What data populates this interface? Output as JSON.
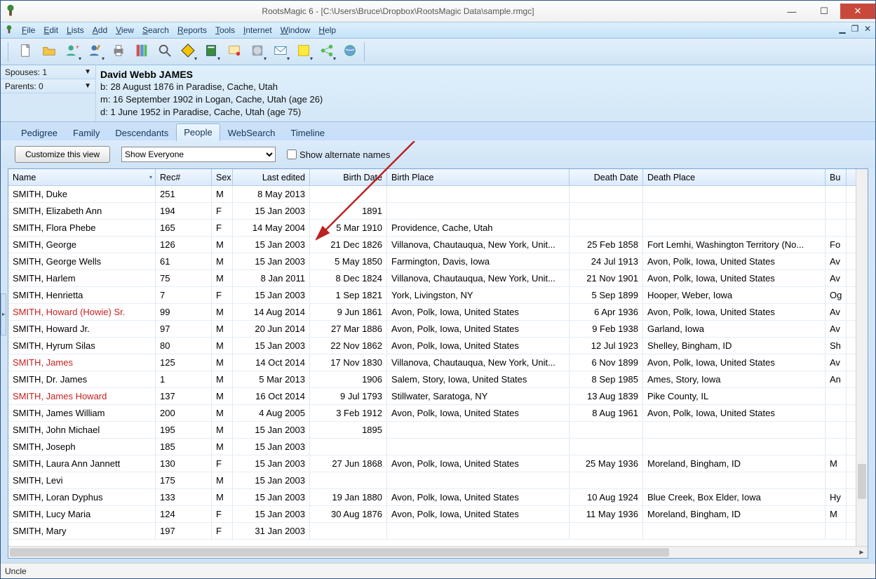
{
  "window": {
    "title": "RootsMagic 6 - [C:\\Users\\Bruce\\Dropbox\\RootsMagic Data\\sample.rmgc]"
  },
  "menu": [
    "File",
    "Edit",
    "Lists",
    "Add",
    "View",
    "Search",
    "Reports",
    "Tools",
    "Internet",
    "Window",
    "Help"
  ],
  "side": {
    "spouses": "Spouses: 1",
    "parents": "Parents: 0"
  },
  "person": {
    "name": "David Webb JAMES",
    "b": "b: 28 August 1876 in Paradise, Cache, Utah",
    "m": "m: 16 September 1902 in Logan, Cache, Utah (age 26)",
    "d": "d: 1 June 1952 in Paradise, Cache, Utah (age 75)"
  },
  "tabs": [
    "Pedigree",
    "Family",
    "Descendants",
    "People",
    "WebSearch",
    "Timeline"
  ],
  "active_tab": 3,
  "controls": {
    "customize": "Customize this view",
    "show": "Show Everyone",
    "alt": "Show alternate names"
  },
  "columns": [
    {
      "key": "name",
      "label": "Name",
      "cls": "c-name"
    },
    {
      "key": "rec",
      "label": "Rec#",
      "cls": "c-rec"
    },
    {
      "key": "sex",
      "label": "Sex",
      "cls": "c-sex"
    },
    {
      "key": "le",
      "label": "Last edited",
      "cls": "c-le",
      "right": true
    },
    {
      "key": "bd",
      "label": "Birth Date",
      "cls": "c-bd",
      "right": true
    },
    {
      "key": "bp",
      "label": "Birth Place",
      "cls": "c-bp"
    },
    {
      "key": "dd",
      "label": "Death Date",
      "cls": "c-dd",
      "right": true
    },
    {
      "key": "dp",
      "label": "Death Place",
      "cls": "c-dp"
    },
    {
      "key": "bu",
      "label": "Bu",
      "cls": "c-bu"
    }
  ],
  "rows": [
    {
      "name": "SMITH, Duke",
      "rec": "251",
      "sex": "M",
      "le": "8 May 2013",
      "bd": "",
      "bp": "",
      "dd": "",
      "dp": "",
      "bu": ""
    },
    {
      "name": "SMITH, Elizabeth Ann",
      "rec": "194",
      "sex": "F",
      "le": "15 Jan 2003",
      "bd": "1891",
      "bp": "",
      "dd": "",
      "dp": "",
      "bu": ""
    },
    {
      "name": "SMITH, Flora Phebe",
      "rec": "165",
      "sex": "F",
      "le": "14 May 2004",
      "bd": "5 Mar 1910",
      "bp": "Providence, Cache, Utah",
      "dd": "",
      "dp": "",
      "bu": ""
    },
    {
      "name": "SMITH, George",
      "rec": "126",
      "sex": "M",
      "le": "15 Jan 2003",
      "bd": "21 Dec 1826",
      "bp": "Villanova, Chautauqua, New York, Unit...",
      "dd": "25 Feb 1858",
      "dp": "Fort Lemhi, Washington Territory (No...",
      "bu": "Fo"
    },
    {
      "name": "SMITH, George Wells",
      "rec": "61",
      "sex": "M",
      "le": "15 Jan 2003",
      "bd": "5 May 1850",
      "bp": "Farmington, Davis, Iowa",
      "dd": "24 Jul 1913",
      "dp": "Avon, Polk, Iowa, United States",
      "bu": "Av"
    },
    {
      "name": "SMITH, Harlem",
      "rec": "75",
      "sex": "M",
      "le": "8 Jan 2011",
      "bd": "8 Dec 1824",
      "bp": "Villanova, Chautauqua, New York, Unit...",
      "dd": "21 Nov 1901",
      "dp": "Avon, Polk, Iowa, United States",
      "bu": "Av"
    },
    {
      "name": "SMITH, Henrietta",
      "rec": "7",
      "sex": "F",
      "le": "15 Jan 2003",
      "bd": "1 Sep 1821",
      "bp": "York, Livingston, NY",
      "dd": "5 Sep 1899",
      "dp": "Hooper, Weber, Iowa",
      "bu": "Og"
    },
    {
      "name": "SMITH, Howard (Howie) Sr.",
      "rec": "99",
      "sex": "M",
      "le": "14 Aug 2014",
      "bd": "9 Jun 1861",
      "bp": "Avon, Polk, Iowa, United States",
      "dd": "6 Apr 1936",
      "dp": "Avon, Polk, Iowa, United States",
      "bu": "Av",
      "red": true
    },
    {
      "name": "SMITH, Howard Jr.",
      "rec": "97",
      "sex": "M",
      "le": "20 Jun 2014",
      "bd": "27 Mar 1886",
      "bp": "Avon, Polk, Iowa, United States",
      "dd": "9 Feb 1938",
      "dp": "Garland, Iowa",
      "bu": "Av"
    },
    {
      "name": "SMITH, Hyrum Silas",
      "rec": "80",
      "sex": "M",
      "le": "15 Jan 2003",
      "bd": "22 Nov 1862",
      "bp": "Avon, Polk, Iowa, United States",
      "dd": "12 Jul 1923",
      "dp": "Shelley, Bingham, ID",
      "bu": "Sh"
    },
    {
      "name": "SMITH, James",
      "rec": "125",
      "sex": "M",
      "le": "14 Oct 2014",
      "bd": "17 Nov 1830",
      "bp": "Villanova, Chautauqua, New York, Unit...",
      "dd": "6 Nov 1899",
      "dp": "Avon, Polk, Iowa, United States",
      "bu": "Av",
      "red": true
    },
    {
      "name": "SMITH, Dr. James",
      "rec": "1",
      "sex": "M",
      "le": "5 Mar 2013",
      "bd": "1906",
      "bp": "Salem, Story, Iowa, United States",
      "dd": "8 Sep 1985",
      "dp": "Ames, Story, Iowa",
      "bu": "An"
    },
    {
      "name": "SMITH, James Howard",
      "rec": "137",
      "sex": "M",
      "le": "16 Oct 2014",
      "bd": "9 Jul 1793",
      "bp": "Stillwater, Saratoga, NY",
      "dd": "13 Aug 1839",
      "dp": "Pike County, IL",
      "bu": "",
      "red": true
    },
    {
      "name": "SMITH, James William",
      "rec": "200",
      "sex": "M",
      "le": "4 Aug 2005",
      "bd": "3 Feb 1912",
      "bp": "Avon, Polk, Iowa, United States",
      "dd": "8 Aug 1961",
      "dp": "Avon, Polk, Iowa, United States",
      "bu": ""
    },
    {
      "name": "SMITH, John Michael",
      "rec": "195",
      "sex": "M",
      "le": "15 Jan 2003",
      "bd": "1895",
      "bp": "",
      "dd": "",
      "dp": "",
      "bu": ""
    },
    {
      "name": "SMITH, Joseph",
      "rec": "185",
      "sex": "M",
      "le": "15 Jan 2003",
      "bd": "",
      "bp": "",
      "dd": "",
      "dp": "",
      "bu": ""
    },
    {
      "name": "SMITH, Laura Ann Jannett",
      "rec": "130",
      "sex": "F",
      "le": "15 Jan 2003",
      "bd": "27 Jun 1868",
      "bp": "Avon, Polk, Iowa, United States",
      "dd": "25 May 1936",
      "dp": "Moreland, Bingham, ID",
      "bu": "M"
    },
    {
      "name": "SMITH, Levi",
      "rec": "175",
      "sex": "M",
      "le": "15 Jan 2003",
      "bd": "",
      "bp": "",
      "dd": "",
      "dp": "",
      "bu": ""
    },
    {
      "name": "SMITH, Loran Dyphus",
      "rec": "133",
      "sex": "M",
      "le": "15 Jan 2003",
      "bd": "19 Jan 1880",
      "bp": "Avon, Polk, Iowa, United States",
      "dd": "10 Aug 1924",
      "dp": "Blue Creek, Box Elder, Iowa",
      "bu": "Hy"
    },
    {
      "name": "SMITH, Lucy Maria",
      "rec": "124",
      "sex": "F",
      "le": "15 Jan 2003",
      "bd": "30 Aug 1876",
      "bp": "Avon, Polk, Iowa, United States",
      "dd": "11 May 1936",
      "dp": "Moreland, Bingham, ID",
      "bu": "M"
    },
    {
      "name": "SMITH, Mary",
      "rec": "197",
      "sex": "F",
      "le": "31 Jan 2003",
      "bd": "",
      "bp": "",
      "dd": "",
      "dp": "",
      "bu": ""
    }
  ],
  "status": "Uncle",
  "toolbar_icons": [
    "new-file",
    "open-folder",
    "add-person",
    "edit-person",
    "print",
    "gedcom",
    "search",
    "road-sign",
    "book",
    "certificate",
    "disk",
    "mail",
    "sticky-note",
    "share",
    "globe"
  ]
}
